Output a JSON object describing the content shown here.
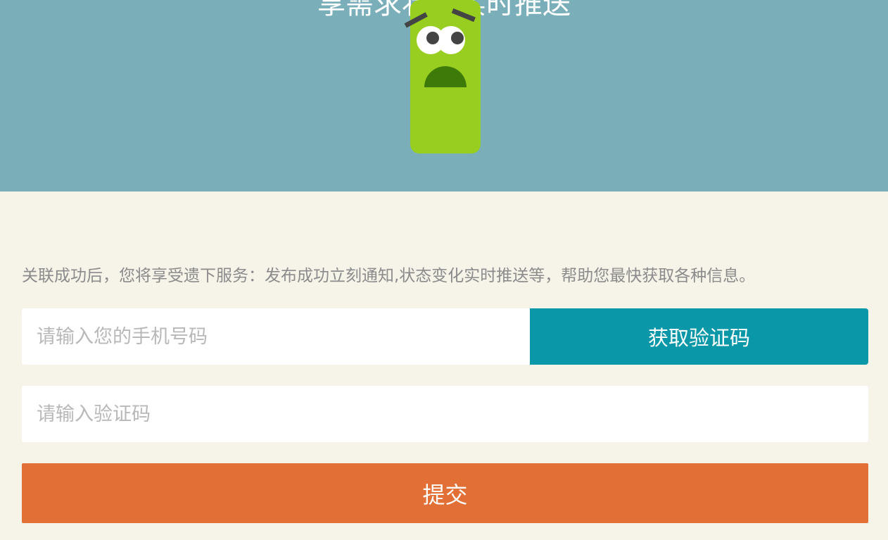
{
  "hero": {
    "title": "享需求状态实时推送",
    "background_color": "#7aaeb8",
    "mascot_icon": "green-monster-icon"
  },
  "form": {
    "description": "关联成功后，您将享受遗下服务：发布成功立刻通知,状态变化实时推送等，帮助您最快获取各种信息。",
    "phone_placeholder": "请输入您的手机号码",
    "get_code_label": "获取验证码",
    "code_placeholder": "请输入验证码",
    "submit_label": "提交"
  },
  "colors": {
    "page_background": "#f6f3e8",
    "accent_teal": "#0a97a8",
    "submit_orange": "#e27036",
    "mascot_green": "#97ce1f"
  }
}
